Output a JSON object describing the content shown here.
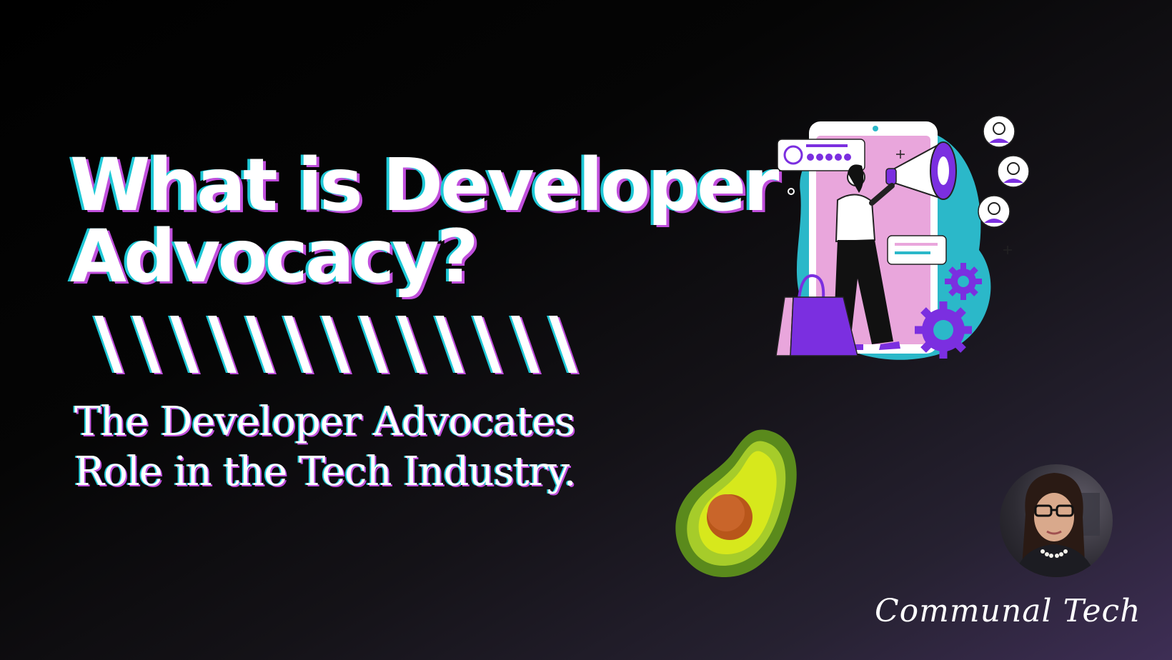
{
  "banner": {
    "title_lines": [
      "What is Developer",
      "Advocacy?"
    ],
    "subtitle_lines": [
      "The Developer Advocates",
      "Role in the Tech Industry."
    ],
    "brand": "Communal Tech"
  },
  "decor": {
    "slash_count": 13,
    "icons": [
      "megaphone-illustration-icon",
      "avocado-icon",
      "author-avatar"
    ]
  },
  "colors": {
    "background": "#000000",
    "accent_cyan": "#1ec8d6",
    "accent_magenta": "#c04fdc",
    "accent_purple": "#7b2fe0",
    "text": "#ffffff"
  }
}
